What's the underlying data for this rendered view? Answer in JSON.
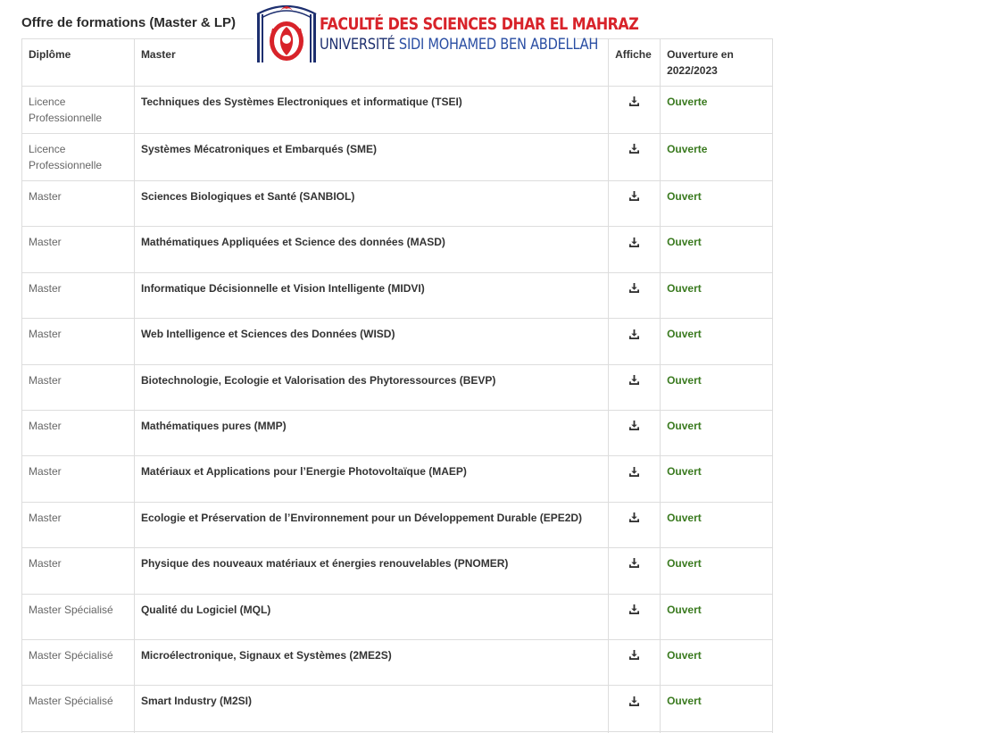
{
  "section": {
    "title": "Offre de formations (Master & LP)"
  },
  "logo": {
    "line1": "FACULTÉ DES SCIENCES DHAR EL MAHRAZ",
    "line2_part1": "UNIVERSITÉ ",
    "line2_part2": "SIDI MOHAMED BEN ABDELLAH",
    "colors": {
      "primary": "#d8232a",
      "secondary": "#1d2f6f"
    }
  },
  "table": {
    "headers": {
      "diplome": "Diplôme",
      "master": "Master",
      "affiche": "Affiche",
      "ouverture": "Ouverture en 2022/2023"
    },
    "rows": [
      {
        "diplome": "Licence Professionnelle",
        "master": "Techniques des Systèmes Electroniques et informatique (TSEI)",
        "status": "Ouverte",
        "icon": "download-icon"
      },
      {
        "diplome": "Licence Professionnelle",
        "master": "Systèmes Mécatroniques et Embarqués (SME)",
        "status": "Ouverte",
        "icon": "download-icon"
      },
      {
        "diplome": "Master",
        "master": "Sciences Biologiques et Santé (SANBIOL)",
        "status": "Ouvert",
        "icon": "download-icon"
      },
      {
        "diplome": "Master",
        "master": "Mathématiques Appliquées et Science des données (MASD)",
        "status": "Ouvert",
        "icon": "download-icon"
      },
      {
        "diplome": "Master",
        "master": "Informatique Décisionnelle et Vision Intelligente (MIDVI)",
        "status": "Ouvert",
        "icon": "download-icon"
      },
      {
        "diplome": "Master",
        "master": "Web Intelligence et Sciences des Données (WISD)",
        "status": "Ouvert",
        "icon": "download-icon"
      },
      {
        "diplome": "Master",
        "master": "Biotechnologie, Ecologie et Valorisation des Phytoressources (BEVP)",
        "status": "Ouvert",
        "icon": "download-icon"
      },
      {
        "diplome": "Master",
        "master": "Mathématiques pures (MMP)",
        "status": "Ouvert",
        "icon": "download-icon"
      },
      {
        "diplome": "Master",
        "master": "Matériaux et Applications pour l’Energie Photovoltaïque (MAEP)",
        "status": "Ouvert",
        "icon": "download-icon"
      },
      {
        "diplome": "Master",
        "master": "Ecologie et Préservation de l’Environnement pour un Développement Durable (EPE2D)",
        "status": "Ouvert",
        "icon": "download-icon"
      },
      {
        "diplome": "Master",
        "master": "Physique des nouveaux matériaux et énergies renouvelables (PNOMER)",
        "status": "Ouvert",
        "icon": "download-icon"
      },
      {
        "diplome": "Master Spécialisé",
        "master": "Qualité du Logiciel (MQL)",
        "status": "Ouvert",
        "icon": "download-icon"
      },
      {
        "diplome": "Master Spécialisé",
        "master": "Microélectronique, Signaux et Systèmes (2ME2S)",
        "status": "Ouvert",
        "icon": "download-icon"
      },
      {
        "diplome": "Master Spécialisé",
        "master": "Smart Industry (M2SI)",
        "status": "Ouvert",
        "icon": "download-icon"
      }
    ],
    "status_color": "#3a7a1f"
  }
}
